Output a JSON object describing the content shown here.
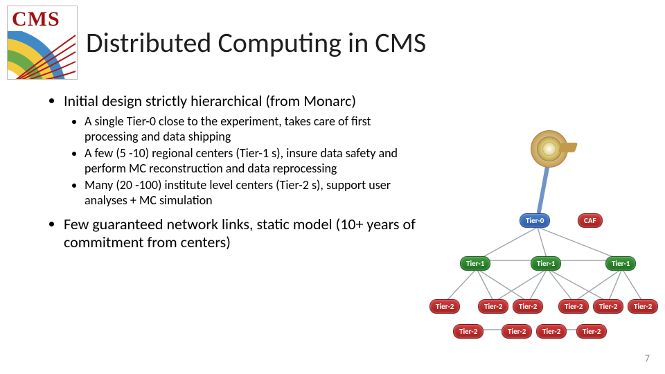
{
  "logo": {
    "label": "CMS"
  },
  "title": "Distributed Computing in CMS",
  "bullets": {
    "b1": "Initial design strictly hierarchical (from Monarc)",
    "b1a": "A single Tier-0 close to the experiment, takes care of first processing and data shipping",
    "b1b": "A few (5 -10) regional centers (Tier-1 s), insure data safety and perform MC reconstruction and data reprocessing",
    "b1c": "Many (20 -100) institute level centers (Tier-2 s), support user analyses + MC simulation",
    "b2": "Few guaranteed network links, static model (10+ years of commitment from centers)"
  },
  "diagram": {
    "tier0": "Tier-0",
    "caf": "CAF",
    "tier1": "Tier-1",
    "tier2": "Tier-2"
  },
  "page_number": "7"
}
